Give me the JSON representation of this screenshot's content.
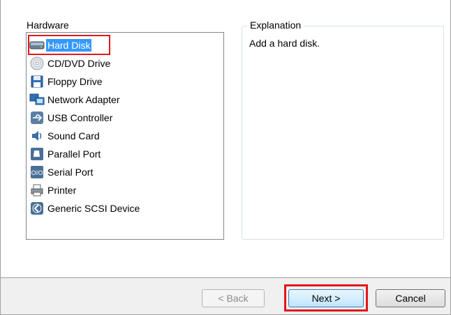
{
  "hardware": {
    "label": "Hardware",
    "items": [
      {
        "label": "Hard Disk",
        "icon": "hard-disk-icon",
        "selected": true
      },
      {
        "label": "CD/DVD Drive",
        "icon": "cd-dvd-icon"
      },
      {
        "label": "Floppy Drive",
        "icon": "floppy-icon"
      },
      {
        "label": "Network Adapter",
        "icon": "network-adapter-icon"
      },
      {
        "label": "USB Controller",
        "icon": "usb-icon"
      },
      {
        "label": "Sound Card",
        "icon": "sound-card-icon"
      },
      {
        "label": "Parallel Port",
        "icon": "parallel-port-icon"
      },
      {
        "label": "Serial Port",
        "icon": "serial-port-icon"
      },
      {
        "label": "Printer",
        "icon": "printer-icon"
      },
      {
        "label": "Generic SCSI Device",
        "icon": "scsi-icon"
      }
    ]
  },
  "explanation": {
    "title": "Explanation",
    "text": "Add a hard disk."
  },
  "buttons": {
    "back": "< Back",
    "next": "Next >",
    "cancel": "Cancel"
  },
  "colors": {
    "selection": "#3399ff",
    "highlight_outline": "#e3161b"
  }
}
